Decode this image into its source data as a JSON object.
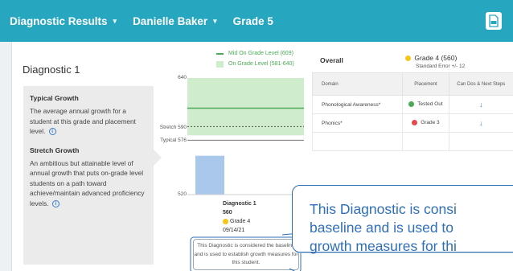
{
  "header": {
    "diagnostic_results": "Diagnostic Results",
    "student_name": "Danielle Baker",
    "grade": "Grade 5",
    "pdf_icon": "pdf-icon"
  },
  "diagnostic_title": "Diagnostic 1",
  "info": {
    "typical_heading": "Typical Growth",
    "typical_text": "The average annual growth for a student at this grade and placement level.",
    "stretch_heading": "Stretch Growth",
    "stretch_text": "An ambitious but attainable level of annual growth that puts on-grade level students on a path toward achieve/maintain advanced proficiency levels."
  },
  "legend": {
    "mid_label": "Mid On Grade Level (609)",
    "range_label": "On Grade Level (581-640)"
  },
  "chart": {
    "y_top_label": "640",
    "stretch_label": "Stretch 590",
    "typical_label": "Typical 576",
    "y_bottom_label": "520",
    "bar_name": "Diagnostic 1",
    "bar_score": "560",
    "bar_grade": "Grade 4",
    "bar_date": "09/14/21",
    "tooltip_text": "This Diagnostic is considered the baseline and is used to establish growth measures for this student."
  },
  "chart_data": {
    "type": "bar",
    "categories": [
      "Diagnostic 1"
    ],
    "values": [
      560
    ],
    "ylim": [
      520,
      640
    ],
    "reference_lines": [
      {
        "name": "Stretch",
        "value": 590
      },
      {
        "name": "Typical",
        "value": 576
      },
      {
        "name": "Mid On Grade Level",
        "value": 609
      }
    ],
    "band": {
      "name": "On Grade Level",
      "range": [
        581,
        640
      ]
    }
  },
  "overall": {
    "label": "Overall",
    "grade_placement": "Grade 4 (560)",
    "standard_error": "Standard Error +/- 12"
  },
  "table": {
    "headers": [
      "Domain",
      "Placement",
      "Can Dos & Next Steps"
    ],
    "rows": [
      {
        "domain": "Phonological Awareness*",
        "placement": "Tested Out",
        "color": "#4aaa55"
      },
      {
        "domain": "Phonics*",
        "placement": "Grade 3",
        "color": "#e5484d"
      }
    ]
  },
  "callout": {
    "line1": "This Diagnostic is consi",
    "line2": "baseline and is used to",
    "line3": "growth measures for thi"
  },
  "colors": {
    "topbar": "#27a6bf",
    "on_grade_band": "#cfedcc",
    "mid_line": "#4aaa55",
    "bar": "#a9c8ec",
    "grade4_dot": "#f5c518",
    "callout_blue": "#2f6fb8"
  }
}
